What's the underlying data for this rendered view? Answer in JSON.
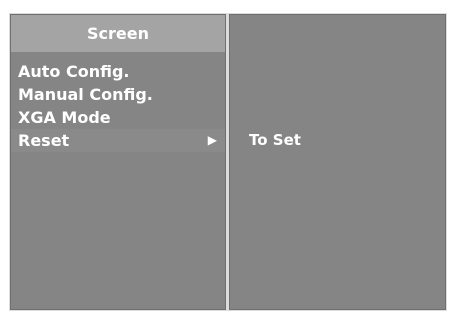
{
  "menu": {
    "title": "Screen",
    "items": [
      {
        "label": "Auto Config."
      },
      {
        "label": "Manual Config."
      },
      {
        "label": "XGA Mode"
      },
      {
        "label": "Reset",
        "selected": true,
        "arrow": "▶"
      }
    ]
  },
  "submenu": {
    "action_label": "To Set"
  },
  "colors": {
    "panel_background": "#858585",
    "header_background": "#a4a4a4",
    "frame": "#dcdcdc",
    "text": "#ffffff"
  },
  "icons": {
    "submenu_arrow": "right-triangle-arrow-icon"
  }
}
